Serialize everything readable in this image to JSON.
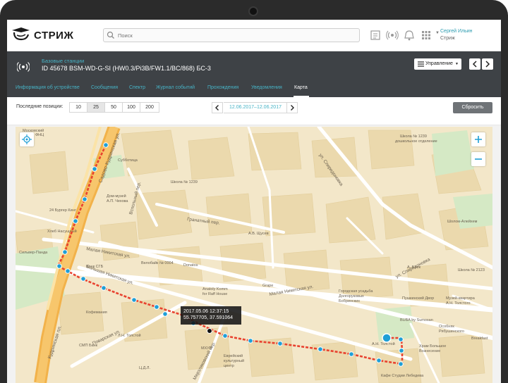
{
  "app": {
    "logo_text": "СТРИЖ",
    "search_placeholder": "Поиск",
    "user_name": "Сергей Ильин",
    "user_org": "Стриж",
    "topbar_icons": [
      "document-icon",
      "antenna-icon",
      "bell-icon",
      "apps-grid-icon"
    ]
  },
  "header": {
    "breadcrumb": "Базовые станции",
    "title": "ID 45678  BSM-WD-G-SI (HW0.3/Pi3B/FW1.1/BC/868) БС-3",
    "control_label": "Управление",
    "tabs": [
      {
        "label": "Информация об устройстве",
        "active": false
      },
      {
        "label": "Сообщения",
        "active": false
      },
      {
        "label": "Спектр",
        "active": false
      },
      {
        "label": "Журнал событий",
        "active": false
      },
      {
        "label": "Прохождения",
        "active": false
      },
      {
        "label": "Уведомления",
        "active": false
      },
      {
        "label": "Карта",
        "active": true
      }
    ]
  },
  "toolbar": {
    "positions_label": "Последние позиции:",
    "positions": [
      "10",
      "25",
      "50",
      "100",
      "200"
    ],
    "selected_position": "25",
    "date_range": "12.06.2017–12.06.2017",
    "reset_label": "Сбросить"
  },
  "map": {
    "tooltip_line1": "2017.05.06   12:37:15",
    "tooltip_line2": "55.757705, 37.591064",
    "route_color": "#e8422f",
    "point_color": "#1f9fd6",
    "controls": [
      "locate-icon",
      "zoom-in-icon",
      "zoom-out-icon"
    ],
    "streets": [
      "ул. Спиридоновка",
      "Гранатный пер.",
      "Малая Никитская ул.",
      "Большая Никитская ул.",
      "Поварская ул.",
      "Кудринская пл.",
      "Садовая-Кудринская ул.",
      "Вспольный пер.",
      "ул. Спиридоновка"
    ],
    "pois": [
      "Московский",
      "24 Бургер Кинг",
      "Хлеб Насущный",
      "Сильвер-Панда",
      "Банк СГБ",
      "Кофемания",
      "Л.Н. Толстой",
      "СМП Банк",
      "Ц.Д.Л.",
      "Субботица",
      "Дом-музей А.П. Чехова",
      "Школа № 1239",
      "Велобайк № 0004",
      "Donatos",
      "Anatoly Komm for Raff House",
      "МХУБ",
      "Евреиский культурный центр",
      "Grape",
      "А.В. Щусев",
      "Городская усадьба Долгоруковых Бобринских",
      "Пушкинский Двор",
      "Музей-квартира А.Н. Толстого",
      "Особняк Рябушинского",
      "BUBA by Sumosan",
      "А.Н. Толстой",
      "Храм Большое Вознесение",
      "Кафе Студии Лебедева",
      "Breakfast",
      "Шолом-Алейхем",
      "А. Блок",
      "Школа № 2123",
      "Школа № 1239 дошкольное отделение"
    ]
  }
}
